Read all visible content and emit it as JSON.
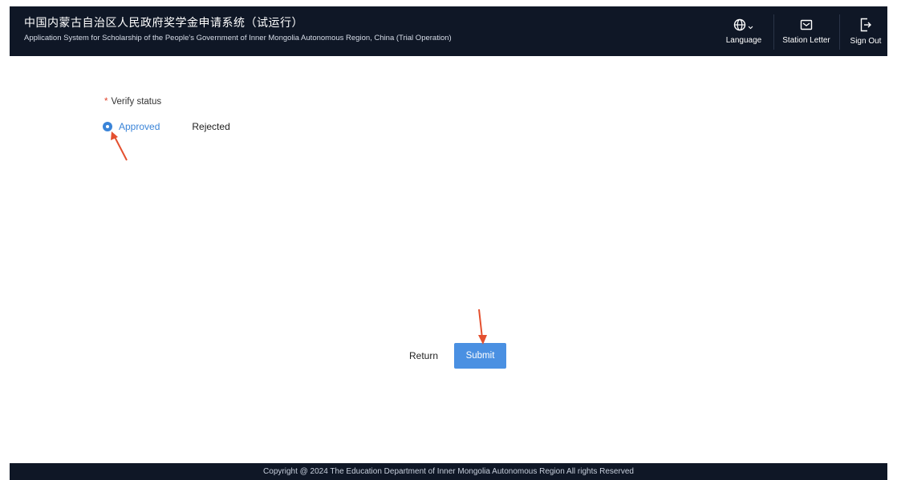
{
  "header": {
    "title_zh": "中国内蒙古自治区人民政府奖学金申请系统（试运行）",
    "title_en": "Application System for Scholarship of the People's Government of Inner Mongolia Autonomous Region, China (Trial Operation)",
    "language_label": "Language",
    "station_letter_label": "Station Letter",
    "sign_out_label": "Sign Out"
  },
  "form": {
    "required_mark": "*",
    "verify_status_label": "Verify status",
    "options": [
      {
        "label": "Approved",
        "selected": true
      },
      {
        "label": "Rejected",
        "selected": false
      }
    ]
  },
  "actions": {
    "return_label": "Return",
    "submit_label": "Submit"
  },
  "footer": {
    "copyright": "Copyright @ 2024 The Education Department of Inner Mongolia Autonomous Region All rights Reserved"
  },
  "colors": {
    "header_bg": "#0f1726",
    "accent": "#3a84d8",
    "submit_bg": "#4a90e2",
    "annotation_arrow": "#e4502f"
  },
  "icons": {
    "language": "globe-icon",
    "station_letter": "mail-icon",
    "sign_out": "sign-out-icon"
  }
}
